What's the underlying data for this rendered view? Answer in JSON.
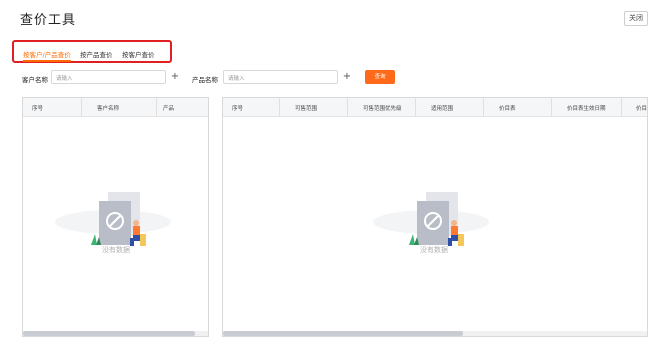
{
  "page": {
    "title": "查价工具",
    "close_label": "关闭"
  },
  "tabs": [
    {
      "label": "按客户/产品查价",
      "active": true
    },
    {
      "label": "按产品查价",
      "active": false
    },
    {
      "label": "按客户查价",
      "active": false
    }
  ],
  "filters": {
    "customer_label": "客户名称",
    "customer_placeholder": "请输入",
    "product_label": "产品名称",
    "product_placeholder": "请输入",
    "plus_symbol": "+",
    "query_label": "查询"
  },
  "left_table": {
    "columns": [
      "序号",
      "客户名称",
      "产品"
    ],
    "empty_text": "没有数据"
  },
  "right_table": {
    "columns": [
      "序号",
      "可售范围",
      "可售范围优先级",
      "适用范围",
      "价目表",
      "价目表生效日期",
      "价目"
    ],
    "empty_text": "没有数据"
  },
  "colors": {
    "accent": "#ff6a00",
    "highlight_border": "#e02020"
  }
}
